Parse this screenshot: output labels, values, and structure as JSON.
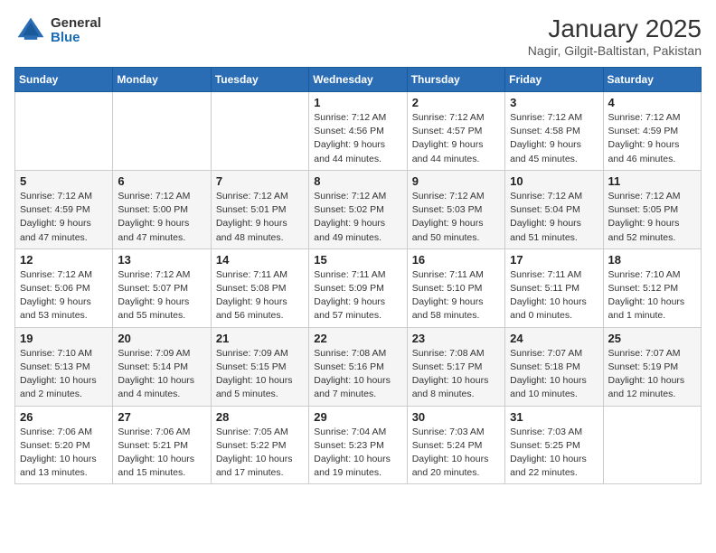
{
  "logo": {
    "general": "General",
    "blue": "Blue"
  },
  "title": "January 2025",
  "subtitle": "Nagir, Gilgit-Baltistan, Pakistan",
  "days_of_week": [
    "Sunday",
    "Monday",
    "Tuesday",
    "Wednesday",
    "Thursday",
    "Friday",
    "Saturday"
  ],
  "weeks": [
    [
      {
        "day": "",
        "sunrise": "",
        "sunset": "",
        "daylight": ""
      },
      {
        "day": "",
        "sunrise": "",
        "sunset": "",
        "daylight": ""
      },
      {
        "day": "",
        "sunrise": "",
        "sunset": "",
        "daylight": ""
      },
      {
        "day": "1",
        "sunrise": "Sunrise: 7:12 AM",
        "sunset": "Sunset: 4:56 PM",
        "daylight": "Daylight: 9 hours and 44 minutes."
      },
      {
        "day": "2",
        "sunrise": "Sunrise: 7:12 AM",
        "sunset": "Sunset: 4:57 PM",
        "daylight": "Daylight: 9 hours and 44 minutes."
      },
      {
        "day": "3",
        "sunrise": "Sunrise: 7:12 AM",
        "sunset": "Sunset: 4:58 PM",
        "daylight": "Daylight: 9 hours and 45 minutes."
      },
      {
        "day": "4",
        "sunrise": "Sunrise: 7:12 AM",
        "sunset": "Sunset: 4:59 PM",
        "daylight": "Daylight: 9 hours and 46 minutes."
      }
    ],
    [
      {
        "day": "5",
        "sunrise": "Sunrise: 7:12 AM",
        "sunset": "Sunset: 4:59 PM",
        "daylight": "Daylight: 9 hours and 47 minutes."
      },
      {
        "day": "6",
        "sunrise": "Sunrise: 7:12 AM",
        "sunset": "Sunset: 5:00 PM",
        "daylight": "Daylight: 9 hours and 47 minutes."
      },
      {
        "day": "7",
        "sunrise": "Sunrise: 7:12 AM",
        "sunset": "Sunset: 5:01 PM",
        "daylight": "Daylight: 9 hours and 48 minutes."
      },
      {
        "day": "8",
        "sunrise": "Sunrise: 7:12 AM",
        "sunset": "Sunset: 5:02 PM",
        "daylight": "Daylight: 9 hours and 49 minutes."
      },
      {
        "day": "9",
        "sunrise": "Sunrise: 7:12 AM",
        "sunset": "Sunset: 5:03 PM",
        "daylight": "Daylight: 9 hours and 50 minutes."
      },
      {
        "day": "10",
        "sunrise": "Sunrise: 7:12 AM",
        "sunset": "Sunset: 5:04 PM",
        "daylight": "Daylight: 9 hours and 51 minutes."
      },
      {
        "day": "11",
        "sunrise": "Sunrise: 7:12 AM",
        "sunset": "Sunset: 5:05 PM",
        "daylight": "Daylight: 9 hours and 52 minutes."
      }
    ],
    [
      {
        "day": "12",
        "sunrise": "Sunrise: 7:12 AM",
        "sunset": "Sunset: 5:06 PM",
        "daylight": "Daylight: 9 hours and 53 minutes."
      },
      {
        "day": "13",
        "sunrise": "Sunrise: 7:12 AM",
        "sunset": "Sunset: 5:07 PM",
        "daylight": "Daylight: 9 hours and 55 minutes."
      },
      {
        "day": "14",
        "sunrise": "Sunrise: 7:11 AM",
        "sunset": "Sunset: 5:08 PM",
        "daylight": "Daylight: 9 hours and 56 minutes."
      },
      {
        "day": "15",
        "sunrise": "Sunrise: 7:11 AM",
        "sunset": "Sunset: 5:09 PM",
        "daylight": "Daylight: 9 hours and 57 minutes."
      },
      {
        "day": "16",
        "sunrise": "Sunrise: 7:11 AM",
        "sunset": "Sunset: 5:10 PM",
        "daylight": "Daylight: 9 hours and 58 minutes."
      },
      {
        "day": "17",
        "sunrise": "Sunrise: 7:11 AM",
        "sunset": "Sunset: 5:11 PM",
        "daylight": "Daylight: 10 hours and 0 minutes."
      },
      {
        "day": "18",
        "sunrise": "Sunrise: 7:10 AM",
        "sunset": "Sunset: 5:12 PM",
        "daylight": "Daylight: 10 hours and 1 minute."
      }
    ],
    [
      {
        "day": "19",
        "sunrise": "Sunrise: 7:10 AM",
        "sunset": "Sunset: 5:13 PM",
        "daylight": "Daylight: 10 hours and 2 minutes."
      },
      {
        "day": "20",
        "sunrise": "Sunrise: 7:09 AM",
        "sunset": "Sunset: 5:14 PM",
        "daylight": "Daylight: 10 hours and 4 minutes."
      },
      {
        "day": "21",
        "sunrise": "Sunrise: 7:09 AM",
        "sunset": "Sunset: 5:15 PM",
        "daylight": "Daylight: 10 hours and 5 minutes."
      },
      {
        "day": "22",
        "sunrise": "Sunrise: 7:08 AM",
        "sunset": "Sunset: 5:16 PM",
        "daylight": "Daylight: 10 hours and 7 minutes."
      },
      {
        "day": "23",
        "sunrise": "Sunrise: 7:08 AM",
        "sunset": "Sunset: 5:17 PM",
        "daylight": "Daylight: 10 hours and 8 minutes."
      },
      {
        "day": "24",
        "sunrise": "Sunrise: 7:07 AM",
        "sunset": "Sunset: 5:18 PM",
        "daylight": "Daylight: 10 hours and 10 minutes."
      },
      {
        "day": "25",
        "sunrise": "Sunrise: 7:07 AM",
        "sunset": "Sunset: 5:19 PM",
        "daylight": "Daylight: 10 hours and 12 minutes."
      }
    ],
    [
      {
        "day": "26",
        "sunrise": "Sunrise: 7:06 AM",
        "sunset": "Sunset: 5:20 PM",
        "daylight": "Daylight: 10 hours and 13 minutes."
      },
      {
        "day": "27",
        "sunrise": "Sunrise: 7:06 AM",
        "sunset": "Sunset: 5:21 PM",
        "daylight": "Daylight: 10 hours and 15 minutes."
      },
      {
        "day": "28",
        "sunrise": "Sunrise: 7:05 AM",
        "sunset": "Sunset: 5:22 PM",
        "daylight": "Daylight: 10 hours and 17 minutes."
      },
      {
        "day": "29",
        "sunrise": "Sunrise: 7:04 AM",
        "sunset": "Sunset: 5:23 PM",
        "daylight": "Daylight: 10 hours and 19 minutes."
      },
      {
        "day": "30",
        "sunrise": "Sunrise: 7:03 AM",
        "sunset": "Sunset: 5:24 PM",
        "daylight": "Daylight: 10 hours and 20 minutes."
      },
      {
        "day": "31",
        "sunrise": "Sunrise: 7:03 AM",
        "sunset": "Sunset: 5:25 PM",
        "daylight": "Daylight: 10 hours and 22 minutes."
      },
      {
        "day": "",
        "sunrise": "",
        "sunset": "",
        "daylight": ""
      }
    ]
  ]
}
